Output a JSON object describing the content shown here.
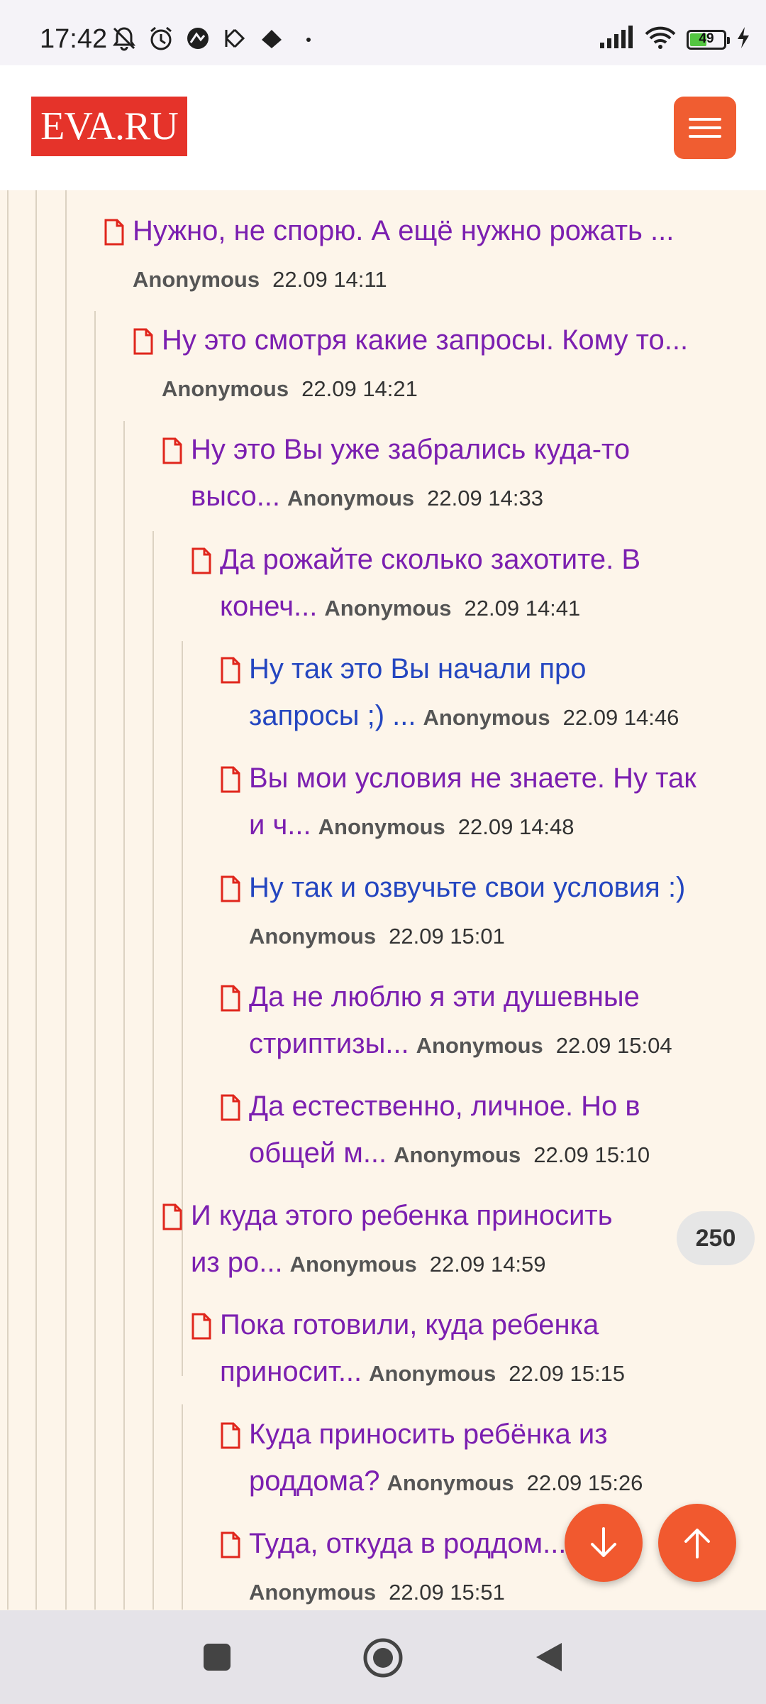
{
  "status_bar": {
    "time": "17:42",
    "battery": "49",
    "icons": [
      "mute-icon",
      "alarm-icon",
      "app-icon",
      "app-icon",
      "app-icon",
      "dot-icon",
      "signal-icon",
      "wifi-icon",
      "battery-icon",
      "charging-icon"
    ]
  },
  "header": {
    "logo": "EVA.RU"
  },
  "posts": [
    {
      "title": "Нужно, не спорю. А ещё нужно рожать ...",
      "author": "Anonymous",
      "date": "22.09 14:11"
    },
    {
      "title": "Ну это смотря какие запросы. Кому то...",
      "author": "Anonymous",
      "date": "22.09 14:21"
    },
    {
      "title_line1": "Ну это Вы уже забрались куда-то",
      "title_line2": "высо...",
      "author": "Anonymous",
      "date": "22.09 14:33"
    },
    {
      "title_line1": "Да рожайте сколько захотите. В",
      "title_line2": "конеч...",
      "author": "Anonymous",
      "date": "22.09 14:41"
    },
    {
      "title_line1": "Ну так это Вы начали про",
      "title_line2": "запросы ;) ...",
      "author": "Anonymous",
      "date": "22.09 14:46"
    },
    {
      "title_line1": "Вы мои условия не знаете. Ну так",
      "title_line2": "и ч...",
      "author": "Anonymous",
      "date": "22.09 14:48"
    },
    {
      "title": "Ну так и озвучьте свои условия :)",
      "author": "Anonymous",
      "date": "22.09 15:01"
    },
    {
      "title_line1": "Да не люблю я эти душевные",
      "title_line2": "стриптизы...",
      "author": "Anonymous",
      "date": "22.09 15:04"
    },
    {
      "title_line1": "Да естественно, личное. Но в",
      "title_line2": "общей м...",
      "author": "Anonymous",
      "date": "22.09 15:10"
    },
    {
      "title_line1": "И куда этого ребенка приносить",
      "title_line2": "из ро...",
      "author": "Anonymous",
      "date": "22.09 14:59"
    },
    {
      "title_line1": "Пока готовили, куда ребенка",
      "title_line2": "приносит...",
      "author": "Anonymous",
      "date": "22.09 15:15"
    },
    {
      "title_line1": "Куда приносить ребёнка из",
      "title_line2": "роддома?",
      "author": "Anonymous",
      "date": "22.09 15:26"
    },
    {
      "title": "Туда, откуда в роддом...",
      "author": "Anonymous",
      "date": "22.09 15:51"
    }
  ],
  "badge": "250",
  "colors": {
    "accent": "#f05d31",
    "logo_bg": "#e5332a",
    "link_purple": "#7b1fb0",
    "link_blue": "#2446c0"
  }
}
